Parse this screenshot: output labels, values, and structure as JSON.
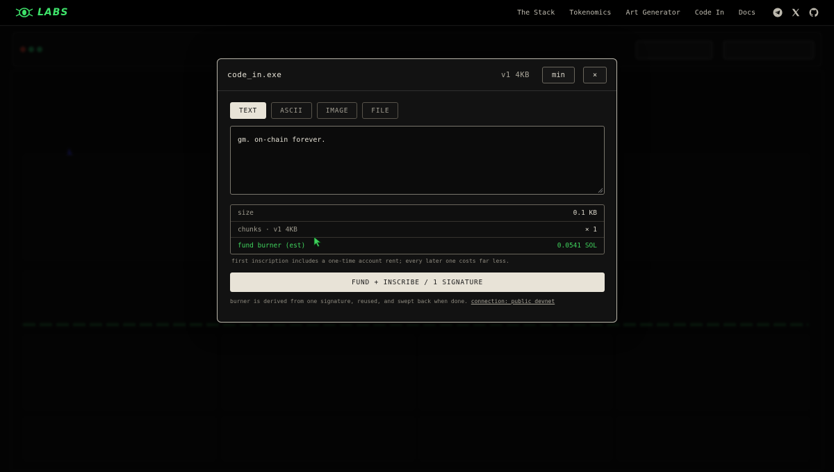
{
  "brand": {
    "name": "LABS"
  },
  "nav": {
    "links": [
      "The Stack",
      "Tokenomics",
      "Art Generator",
      "Code In",
      "Docs"
    ],
    "icons": [
      "telegram-icon",
      "x-icon",
      "github-icon"
    ]
  },
  "modal": {
    "title": "code_in.exe",
    "meta": "v1 4KB",
    "min_label": "min",
    "close_label": "×",
    "tabs": [
      "TEXT",
      "ASCII",
      "IMAGE",
      "FILE"
    ],
    "active_tab": "TEXT",
    "input_value": "gm. on-chain forever.",
    "stats": {
      "size_label": "size",
      "size_value": "0.1 KB",
      "chunks_label": "chunks · v1 4KB",
      "chunks_value": "× 1",
      "fund_label": "fund burner (est)",
      "fund_value": "0.0541 SOL"
    },
    "note": "first inscription includes a one-time account rent; every later one costs far less.",
    "primary_button": "FUND + INSCRIBE / 1 SIGNATURE",
    "footer_text": "burner is derived from one signature, reused, and swept back when done.",
    "footer_link": "connection: public devnet"
  },
  "colors": {
    "accent_green": "#3fd15c",
    "brand_green": "#3ee26a",
    "button_light": "#e8e3d7",
    "background": "#060606"
  }
}
